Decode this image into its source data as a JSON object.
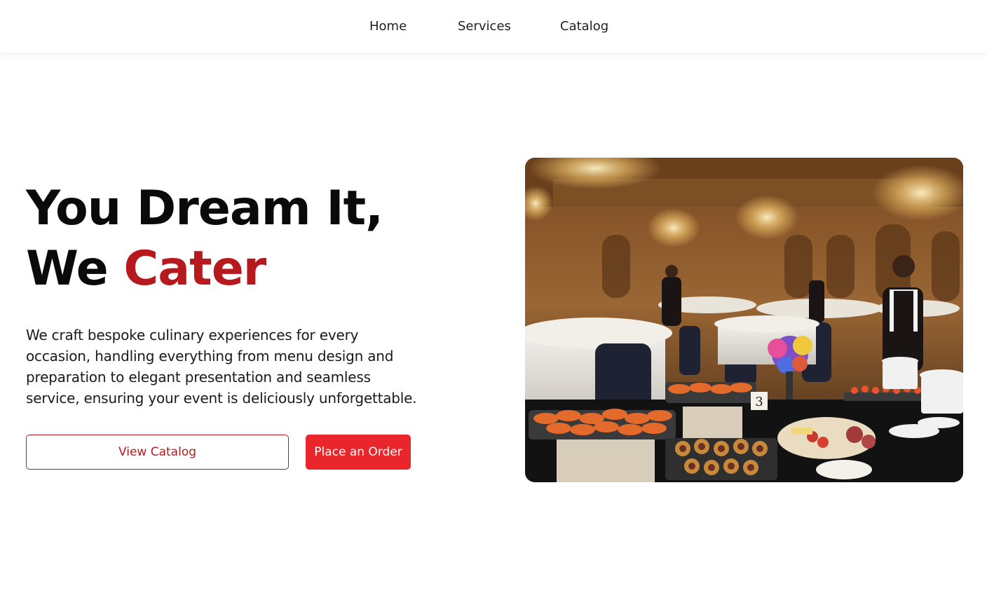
{
  "nav": {
    "items": [
      {
        "label": "Home"
      },
      {
        "label": "Services"
      },
      {
        "label": "Catalog"
      }
    ]
  },
  "hero": {
    "title_line1": "You Dream It,",
    "title_line2_prefix": "We",
    "title_line2_accent": "Cater",
    "description": "We craft bespoke culinary experiences for every occasion, handling everything from menu design and preparation to elegant presentation and seamless service, ensuring your event is deliciously unforgettable.",
    "primary_button": "View Catalog",
    "secondary_button": "Place an Order",
    "image_table_number": "3"
  },
  "colors": {
    "accent": "#b71a1e",
    "button_red": "#e8262b"
  }
}
